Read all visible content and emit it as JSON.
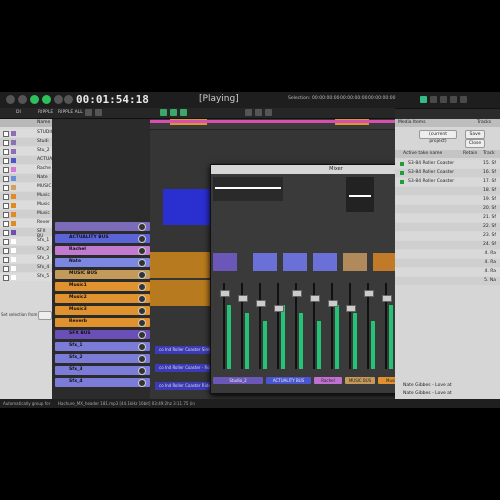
{
  "transport": {
    "clock": "00:01:54:18",
    "state": "[Playing]",
    "selection_label": "Selection:",
    "selection_start": "00:00:00:00",
    "selection_end": "00:00:00:00",
    "selection_len": "00:00:00:00",
    "btn_labels": [
      "DI",
      "RIPPLE",
      "RIPPLE ALL"
    ]
  },
  "left_pane": {
    "header": "Name",
    "rows": [
      {
        "name": "STUDIO",
        "color": "#8f6fb3"
      },
      {
        "name": "Studi",
        "color": "#8f6fb3"
      },
      {
        "name": "Stu_2",
        "color": "#8f6fb3"
      },
      {
        "name": "ACTUAL",
        "color": "#4b57c9"
      },
      {
        "name": "Rache",
        "color": "#d47ad4"
      },
      {
        "name": "Nate",
        "color": "#6a8fd6"
      },
      {
        "name": "MUSIC",
        "color": "#d0a25a"
      },
      {
        "name": "Music",
        "color": "#e08a22"
      },
      {
        "name": "Music",
        "color": "#e08a22"
      },
      {
        "name": "Music",
        "color": "#e08a22"
      },
      {
        "name": "Rever",
        "color": "#e08a22"
      },
      {
        "name": "SFX BU",
        "color": "#6f4fb3"
      },
      {
        "name": "Sfx_1",
        "color": "#ffffff"
      },
      {
        "name": "Sfx_2",
        "color": "#ffffff"
      },
      {
        "name": "Sfx_3",
        "color": "#ffffff"
      },
      {
        "name": "Sfx_4",
        "color": "#ffffff"
      },
      {
        "name": "Sfx_5",
        "color": "#ffffff"
      }
    ],
    "footer": "Set selection from"
  },
  "tracks": [
    {
      "name": "",
      "color": "#7c6bb8"
    },
    {
      "name": "ACTUALITY BUS",
      "color": "#5b63d8"
    },
    {
      "name": "Rachel",
      "color": "#c07ad0"
    },
    {
      "name": "Nate",
      "color": "#7b87e0"
    },
    {
      "name": "MUSIC BUS",
      "color": "#c49a5a"
    },
    {
      "name": "Music1",
      "color": "#e0922f"
    },
    {
      "name": "Music2",
      "color": "#e0922f"
    },
    {
      "name": "Music3",
      "color": "#e0922f"
    },
    {
      "name": "Reverb",
      "color": "#e0922f"
    },
    {
      "name": "SFX BUS",
      "color": "#6b4fb8"
    },
    {
      "name": "Sfx_1",
      "color": "#7b7bd8"
    },
    {
      "name": "Sfx_2",
      "color": "#7b7bd8"
    },
    {
      "name": "Sfx_3",
      "color": "#7b7bd8"
    },
    {
      "name": "Sfx_4",
      "color": "#7b7bd8"
    }
  ],
  "markers": [
    "Transition to Mud",
    "Back to Present"
  ],
  "mixer": {
    "title": "Mixer",
    "strip_labels": [
      "Studio_2",
      "ACTUALITY BUS",
      "Rachel",
      "MUSIC BUS",
      "Music1"
    ],
    "plugin_labels": [
      "a-Compre",
      "a-Compre",
      "a-Compre",
      "a-Compre",
      "a-Compre"
    ],
    "meter_readout": "-18.2 -20.5",
    "meter_readout2": "1.6K 1.0LRA1.0",
    "meter_readout3": "-22.0 -23.7 -24.0"
  },
  "right_pane": {
    "tabs": [
      "Media Items",
      "Tracks"
    ],
    "project": "(current project)",
    "save": "Save",
    "close": "Close",
    "header_name": "Active take name",
    "header_retain": "Retain",
    "header_track": "Track",
    "rows": [
      {
        "name": "S3-84 Roller Coaster",
        "num": "15. Sf"
      },
      {
        "name": "S3-84 Roller Coaster",
        "num": "16. Sf"
      },
      {
        "name": "S3-84 Roller Coaster",
        "num": "17. Sf"
      },
      {
        "name": "",
        "num": "18. Sf"
      },
      {
        "name": "",
        "num": "19. Sf"
      },
      {
        "name": "",
        "num": "20. Sf"
      },
      {
        "name": "",
        "num": "21. Sf"
      },
      {
        "name": "",
        "num": "22. Sf"
      },
      {
        "name": "",
        "num": "23. Sf"
      },
      {
        "name": "",
        "num": "24. Sf"
      },
      {
        "name": "",
        "num": "4. Ra"
      },
      {
        "name": "",
        "num": "4. Ra"
      },
      {
        "name": "",
        "num": "4. Ra"
      },
      {
        "name": "",
        "num": "5. Na"
      }
    ],
    "tail_rows": [
      "Nate Gibbes - Love at",
      "Nate Gibbes - Love at"
    ],
    "buttons": [
      "Usage",
      "Replace",
      "Remove"
    ]
  },
  "clips": [
    "co Ind Roller Coaster SimInd.Roller Coaster",
    "co Ind Roller Coaster - Roller Coaster Ride",
    "co Ind Roller Coaster Ride - Simulated Amusement"
  ],
  "statusbar": {
    "left": "Automatically group for",
    "mid": "Hachure_MX_header 181.mp3 [44.1kHz 16bit] 03:49:2hz 3:11.75 (in"
  }
}
